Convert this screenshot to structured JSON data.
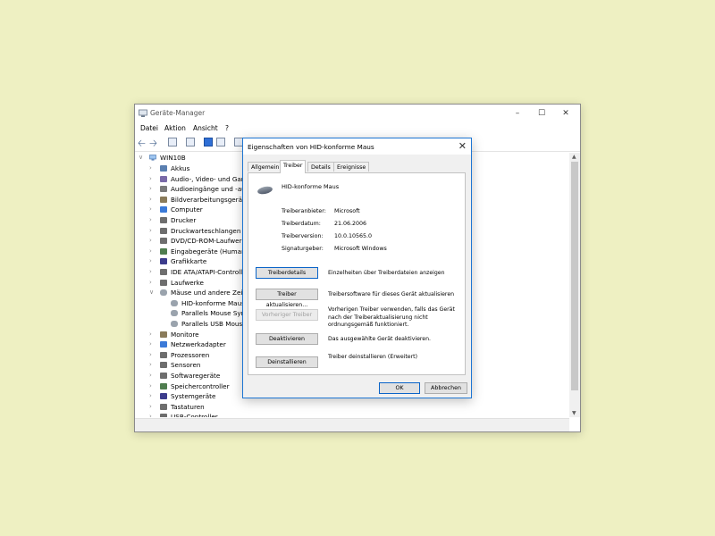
{
  "window": {
    "title": "Geräte-Manager",
    "menu": [
      "Datei",
      "Aktion",
      "Ansicht",
      "?"
    ]
  },
  "tree": {
    "root": "WIN10B",
    "items": [
      {
        "label": "Akkus",
        "icon": "battery-icon",
        "expanded": false
      },
      {
        "label": "Audio-, Video- und Gam",
        "icon": "audio-video-icon",
        "expanded": false
      },
      {
        "label": "Audioeingänge und -au",
        "icon": "audio-io-icon",
        "expanded": false
      },
      {
        "label": "Bildverarbeitungsgeräte",
        "icon": "imaging-icon",
        "expanded": false
      },
      {
        "label": "Computer",
        "icon": "computer-icon",
        "expanded": false
      },
      {
        "label": "Drucker",
        "icon": "printer-icon",
        "expanded": false
      },
      {
        "label": "Druckwarteschlangen",
        "icon": "print-queue-icon",
        "expanded": false
      },
      {
        "label": "DVD/CD-ROM-Laufwer",
        "icon": "dvd-icon",
        "expanded": false
      },
      {
        "label": "Eingabegeräte (Human",
        "icon": "hid-icon",
        "expanded": false
      },
      {
        "label": "Grafikkarte",
        "icon": "graphics-card-icon",
        "expanded": false
      },
      {
        "label": "IDE ATA/ATAPI-Controll",
        "icon": "ide-icon",
        "expanded": false
      },
      {
        "label": "Laufwerke",
        "icon": "drive-icon",
        "expanded": false
      },
      {
        "label": "Mäuse und andere Zeig",
        "icon": "mouse-icon",
        "expanded": true
      },
      {
        "label": "HID-konforme Maus",
        "icon": "mouse-icon",
        "child": true
      },
      {
        "label": "Parallels Mouse Sync",
        "icon": "mouse-icon",
        "child": true
      },
      {
        "label": "Parallels USB Mouse",
        "icon": "mouse-icon",
        "child": true
      },
      {
        "label": "Monitore",
        "icon": "monitor-icon",
        "expanded": false
      },
      {
        "label": "Netzwerkadapter",
        "icon": "network-icon",
        "expanded": false
      },
      {
        "label": "Prozessoren",
        "icon": "processor-icon",
        "expanded": false
      },
      {
        "label": "Sensoren",
        "icon": "sensor-icon",
        "expanded": false
      },
      {
        "label": "Softwaregeräte",
        "icon": "software-device-icon",
        "expanded": false
      },
      {
        "label": "Speichercontroller",
        "icon": "storage-controller-icon",
        "expanded": false
      },
      {
        "label": "Systemgeräte",
        "icon": "system-device-icon",
        "expanded": false
      },
      {
        "label": "Tastaturen",
        "icon": "keyboard-icon",
        "expanded": false
      },
      {
        "label": "USB-Controller",
        "icon": "usb-icon",
        "expanded": false
      }
    ]
  },
  "dialog": {
    "title": "Eigenschaften von HID-konforme Maus",
    "tabs": [
      "Allgemein",
      "Treiber",
      "Details",
      "Ereignisse"
    ],
    "active_tab": "Treiber",
    "device_name": "HID-konforme Maus",
    "info": [
      {
        "key": "Treiberanbieter:",
        "value": "Microsoft"
      },
      {
        "key": "Treiberdatum:",
        "value": "21.06.2006"
      },
      {
        "key": "Treiberversion:",
        "value": "10.0.10565.0"
      },
      {
        "key": "Signaturgeber:",
        "value": "Microsoft Windows"
      }
    ],
    "actions": [
      {
        "button": "Treiberdetails",
        "description": "Einzelheiten über Treiberdateien anzeigen",
        "enabled": true
      },
      {
        "button": "Treiber aktualisieren...",
        "description": "Treibersoftware für dieses Gerät aktualisieren",
        "enabled": true
      },
      {
        "button": "Vorheriger Treiber",
        "description": "Vorherigen Treiber verwenden, falls das Gerät nach der Treiberaktualisierung nicht ordnungsgemäß funktioniert.",
        "enabled": false
      },
      {
        "button": "Deaktivieren",
        "description": "Das ausgewählte Gerät deaktivieren.",
        "enabled": true
      },
      {
        "button": "Deinstallieren",
        "description": "Treiber deinstallieren (Erweitert)",
        "enabled": true
      }
    ],
    "ok": "OK",
    "cancel": "Abbrechen"
  },
  "colors": {
    "background": "#eef0c2",
    "accent": "#1e76d3"
  }
}
